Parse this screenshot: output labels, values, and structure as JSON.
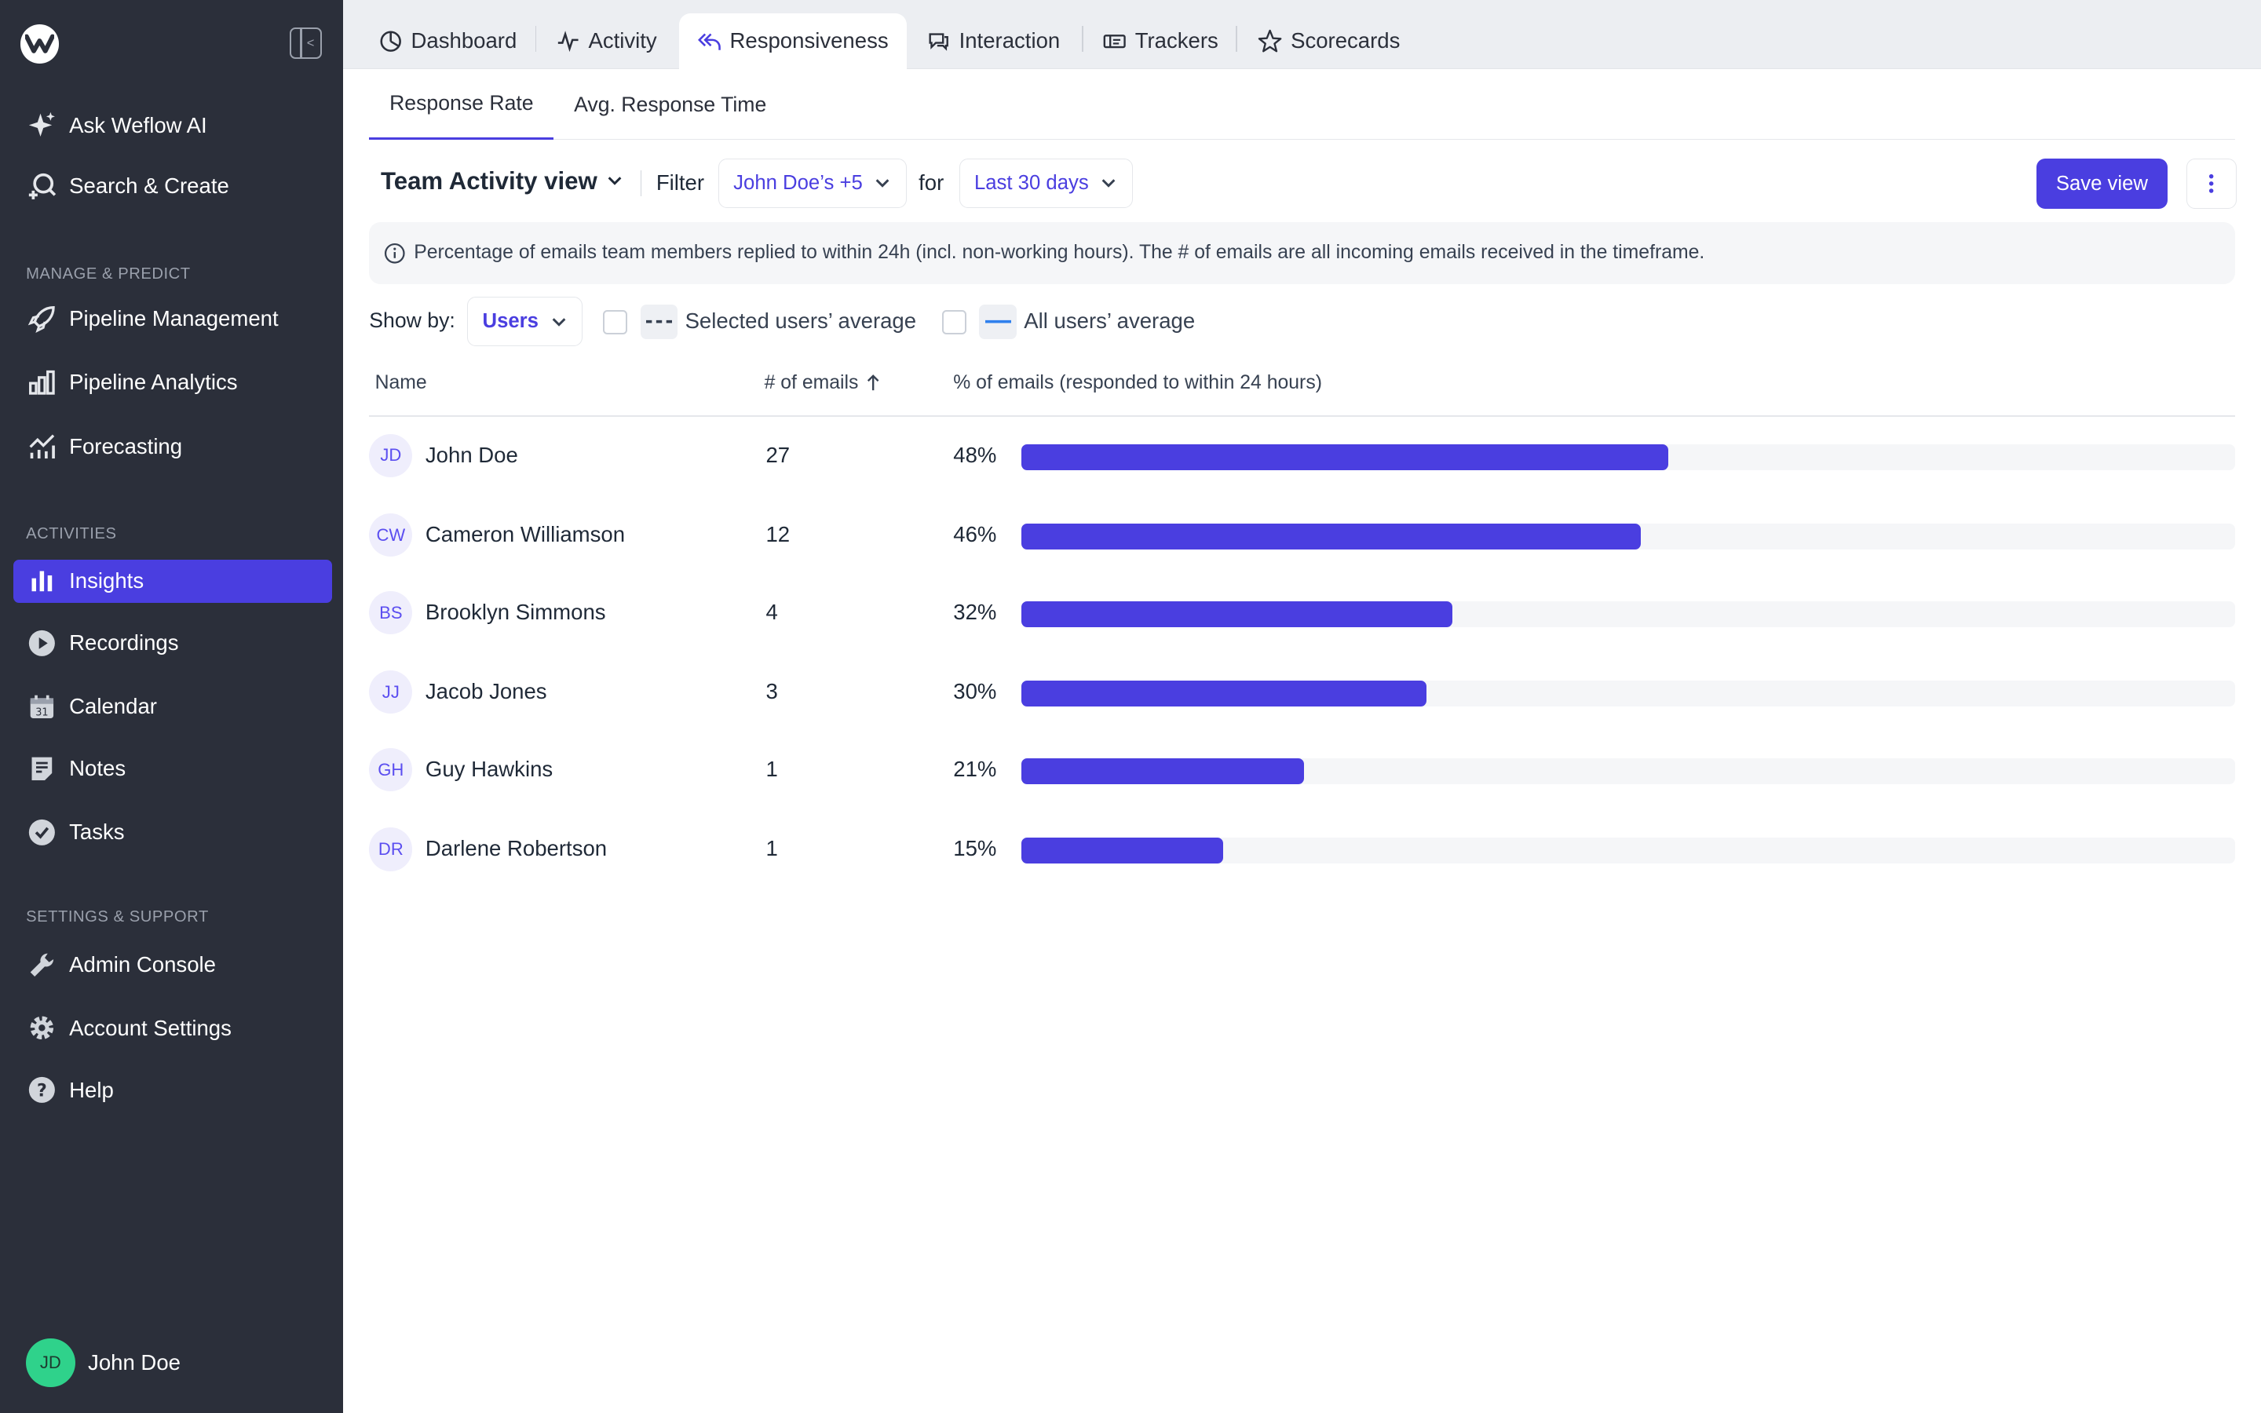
{
  "sidebar": {
    "ask_ai": "Ask Weflow AI",
    "search_create": "Search & Create",
    "section_manage": "MANAGE & PREDICT",
    "pipeline_management": "Pipeline Management",
    "pipeline_analytics": "Pipeline Analytics",
    "forecasting": "Forecasting",
    "section_activities": "ACTIVITIES",
    "insights": "Insights",
    "recordings": "Recordings",
    "calendar": "Calendar",
    "notes": "Notes",
    "tasks": "Tasks",
    "section_settings": "SETTINGS & SUPPORT",
    "admin_console": "Admin Console",
    "account_settings": "Account Settings",
    "help": "Help",
    "user_initials": "JD",
    "user_name": "John Doe"
  },
  "tabs": {
    "dashboard": "Dashboard",
    "activity": "Activity",
    "responsiveness": "Responsiveness",
    "interaction": "Interaction",
    "trackers": "Trackers",
    "scorecards": "Scorecards"
  },
  "subtabs": {
    "response_rate": "Response Rate",
    "avg_response_time": "Avg. Response Time"
  },
  "toolbar": {
    "view_name": "Team Activity view",
    "filter_label": "Filter",
    "filter_value": "John Doe’s +5",
    "for_label": "for",
    "period_value": "Last 30 days",
    "save_view": "Save view"
  },
  "info_text": "Percentage of emails team members replied to within 24h (incl. non-working hours). The # of emails are all incoming emails received in the timeframe.",
  "controls": {
    "show_by_label": "Show by:",
    "show_by_value": "Users",
    "selected_avg_label": "Selected users’ average",
    "all_avg_label": "All users’ average"
  },
  "table": {
    "col_name": "Name",
    "col_emails": "# of emails",
    "col_pct": "% of emails (responded to within 24 hours)"
  },
  "chart_data": {
    "type": "bar",
    "categories": [
      "John Doe",
      "Cameron Williamson",
      "Brooklyn Simmons",
      "Jacob Jones",
      "Guy Hawkins",
      "Darlene Robertson"
    ],
    "initials": [
      "JD",
      "CW",
      "BS",
      "JJ",
      "GH",
      "DR"
    ],
    "emails": [
      27,
      12,
      4,
      3,
      1,
      1
    ],
    "values": [
      48,
      46,
      32,
      30,
      21,
      15
    ],
    "labels": [
      "48%",
      "46%",
      "32%",
      "30%",
      "21%",
      "15%"
    ],
    "ylim": [
      0,
      90
    ],
    "bar_color": "#4a3ee0"
  },
  "colors": {
    "accent": "#4a3ee0",
    "sidebar_bg": "#2b2f3a",
    "avatar_green": "#2fd28b"
  }
}
